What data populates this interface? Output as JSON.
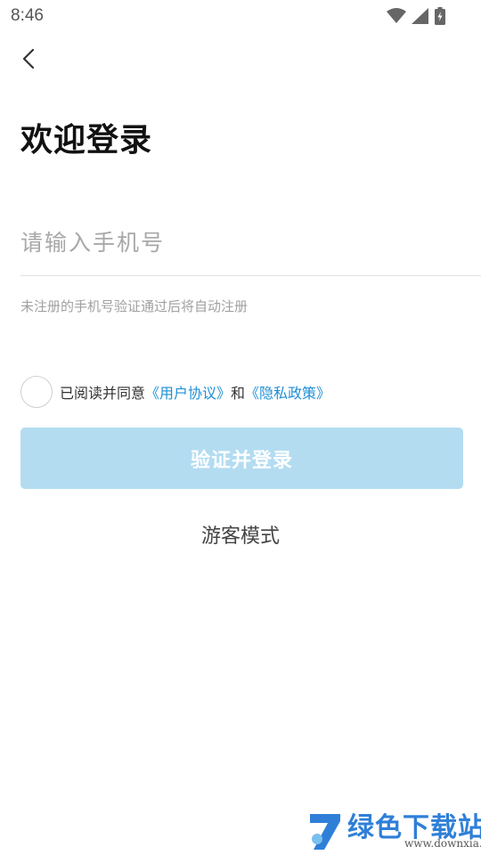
{
  "status_bar": {
    "time": "8:46"
  },
  "nav": {
    "back_icon": "chevron-left-icon"
  },
  "login": {
    "title": "欢迎登录",
    "phone_placeholder": "请输入手机号",
    "phone_value": "",
    "hint": "未注册的手机号验证通过后将自动注册",
    "agreement": {
      "prefix": "已阅读并同意",
      "user_agreement": "《用户协议》",
      "conjunction": "和",
      "privacy_policy": "《隐私政策》",
      "checked": false
    },
    "submit_label": "验证并登录",
    "guest_label": "游客模式"
  },
  "watermark": {
    "title": "绿色下载站",
    "url": "www.downxia.com"
  },
  "colors": {
    "accent": "#1e8fd6",
    "button_disabled": "#b3dcf1",
    "watermark_blue": "#2f7fd8"
  }
}
